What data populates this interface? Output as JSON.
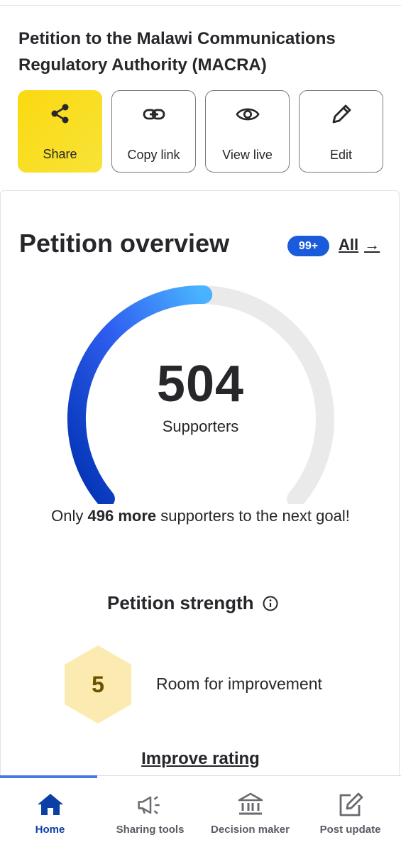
{
  "petition": {
    "title": "Petition to the Malawi Communications Regulatory Authority (MACRA)"
  },
  "actions": [
    {
      "label": "Share",
      "icon": "share-icon"
    },
    {
      "label": "Copy link",
      "icon": "link-icon"
    },
    {
      "label": "View live",
      "icon": "eye-icon"
    },
    {
      "label": "Edit",
      "icon": "pencil-icon"
    }
  ],
  "overview": {
    "title": "Petition overview",
    "badge": "99+",
    "all_label": "All",
    "supporters_count": "504",
    "supporters_label": "Supporters",
    "goal_progress_fraction": 0.504,
    "goal_prefix": "Only",
    "goal_bold": "496 more",
    "goal_suffix": "supporters to the next goal!"
  },
  "strength": {
    "title": "Petition strength",
    "score": "5",
    "description": "Room for improvement",
    "improve_label": "Improve rating"
  },
  "nav": [
    {
      "label": "Home",
      "icon": "home-icon",
      "active": true
    },
    {
      "label": "Sharing tools",
      "icon": "megaphone-icon",
      "active": false
    },
    {
      "label": "Decision maker",
      "icon": "bank-icon",
      "active": false
    },
    {
      "label": "Post update",
      "icon": "edit-square-icon",
      "active": false
    }
  ],
  "colors": {
    "share_yellow": "#fbd910",
    "badge_blue": "#1a5bdc",
    "gauge_dark_blue": "#0033b5",
    "gauge_light_blue": "#4ab3ff",
    "hex_yellow": "#fcebb0",
    "nav_active": "#0a3fa6"
  }
}
